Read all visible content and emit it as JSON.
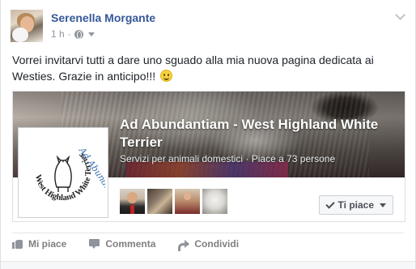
{
  "post": {
    "author": "Serenella Morgante",
    "time": "1 h",
    "separator": "·",
    "audience_icon": "globe-icon",
    "text": "Vorrei invitarvi tutti a dare uno sguado alla mia nuova pagina dedicata ai Westies. Grazie in anticipo!!!",
    "emoji": "wink-emoji"
  },
  "shared_page": {
    "title": "Ad Abundantiam - West Highland White Terrier",
    "category": "Servizi per animali domestici",
    "likes_text": "Piace a 73 persone",
    "separator": "·",
    "logo_script_text": "Ad Abundantiam",
    "logo_ring_text": "West Highland White Terrier",
    "like_button_label": "Ti piace"
  },
  "actions": {
    "like": "Mi piace",
    "comment": "Commenta",
    "share": "Condividi"
  },
  "colors": {
    "author_link": "#365899",
    "logo_blue": "#3a6fb0",
    "muted": "#90949c"
  }
}
